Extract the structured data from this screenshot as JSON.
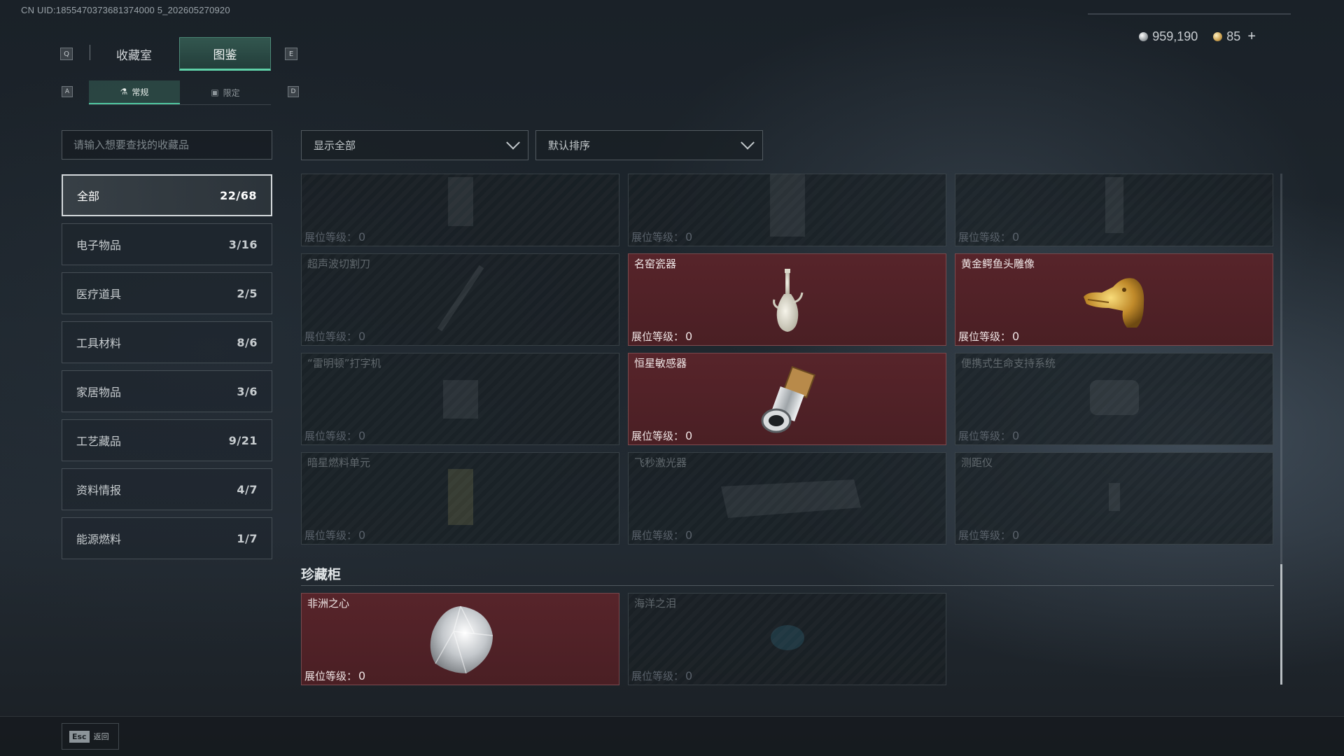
{
  "uid": "CN UID:1855470373681374000 5_202605270920",
  "currency": {
    "silver_icon": "silver-coin-icon",
    "silver": "959,190",
    "gold_icon": "gold-coin-icon",
    "gold": "85",
    "plus": "+"
  },
  "keys": {
    "q": "Q",
    "e": "E",
    "a": "A",
    "d": "D",
    "esc": "Esc"
  },
  "tabs": [
    {
      "label": "收藏室",
      "active": false
    },
    {
      "label": "图鉴",
      "active": true
    }
  ],
  "subtabs": [
    {
      "label": "常规",
      "icon": "flask-icon",
      "active": true
    },
    {
      "label": "限定",
      "icon": "box-icon",
      "active": false
    }
  ],
  "search": {
    "placeholder": "请输入想要查找的收藏品",
    "value": ""
  },
  "categories": [
    {
      "label": "全部",
      "count": "22/68",
      "active": true
    },
    {
      "label": "电子物品",
      "count": "3/16"
    },
    {
      "label": "医疗道具",
      "count": "2/5"
    },
    {
      "label": "工具材料",
      "count": "8/6"
    },
    {
      "label": "家居物品",
      "count": "3/6"
    },
    {
      "label": "工艺藏品",
      "count": "9/21"
    },
    {
      "label": "资料情报",
      "count": "4/7"
    },
    {
      "label": "能源燃料",
      "count": "1/7"
    }
  ],
  "filters": {
    "show": "显示全部",
    "sort": "默认排序"
  },
  "level_label": "展位等级：",
  "items": [
    {
      "name": "",
      "level": "0",
      "owned": false
    },
    {
      "name": "",
      "level": "0",
      "owned": false
    },
    {
      "name": "",
      "level": "0",
      "owned": false
    },
    {
      "name": "超声波切割刀",
      "level": "0",
      "owned": false
    },
    {
      "name": "名窑瓷器",
      "level": "0",
      "owned": true
    },
    {
      "name": "黄金鳄鱼头雕像",
      "level": "0",
      "owned": true
    },
    {
      "name": "“雷明顿”打字机",
      "level": "0",
      "owned": false
    },
    {
      "name": "恒星敏感器",
      "level": "0",
      "owned": true
    },
    {
      "name": "便携式生命支持系统",
      "level": "0",
      "owned": false
    },
    {
      "name": "暗星燃料单元",
      "level": "0",
      "owned": false
    },
    {
      "name": "飞秒激光器",
      "level": "0",
      "owned": false
    },
    {
      "name": "测距仪",
      "level": "0",
      "owned": false
    }
  ],
  "section": {
    "title": "珍藏柜"
  },
  "treasures": [
    {
      "name": "非洲之心",
      "level": "0",
      "owned": true
    },
    {
      "name": "海洋之泪",
      "level": "0",
      "owned": false
    }
  ],
  "footer": {
    "back": "返回"
  },
  "colors": {
    "accent": "#5fd1a8",
    "owned_card": "#57242a",
    "card": "#1e252b"
  }
}
